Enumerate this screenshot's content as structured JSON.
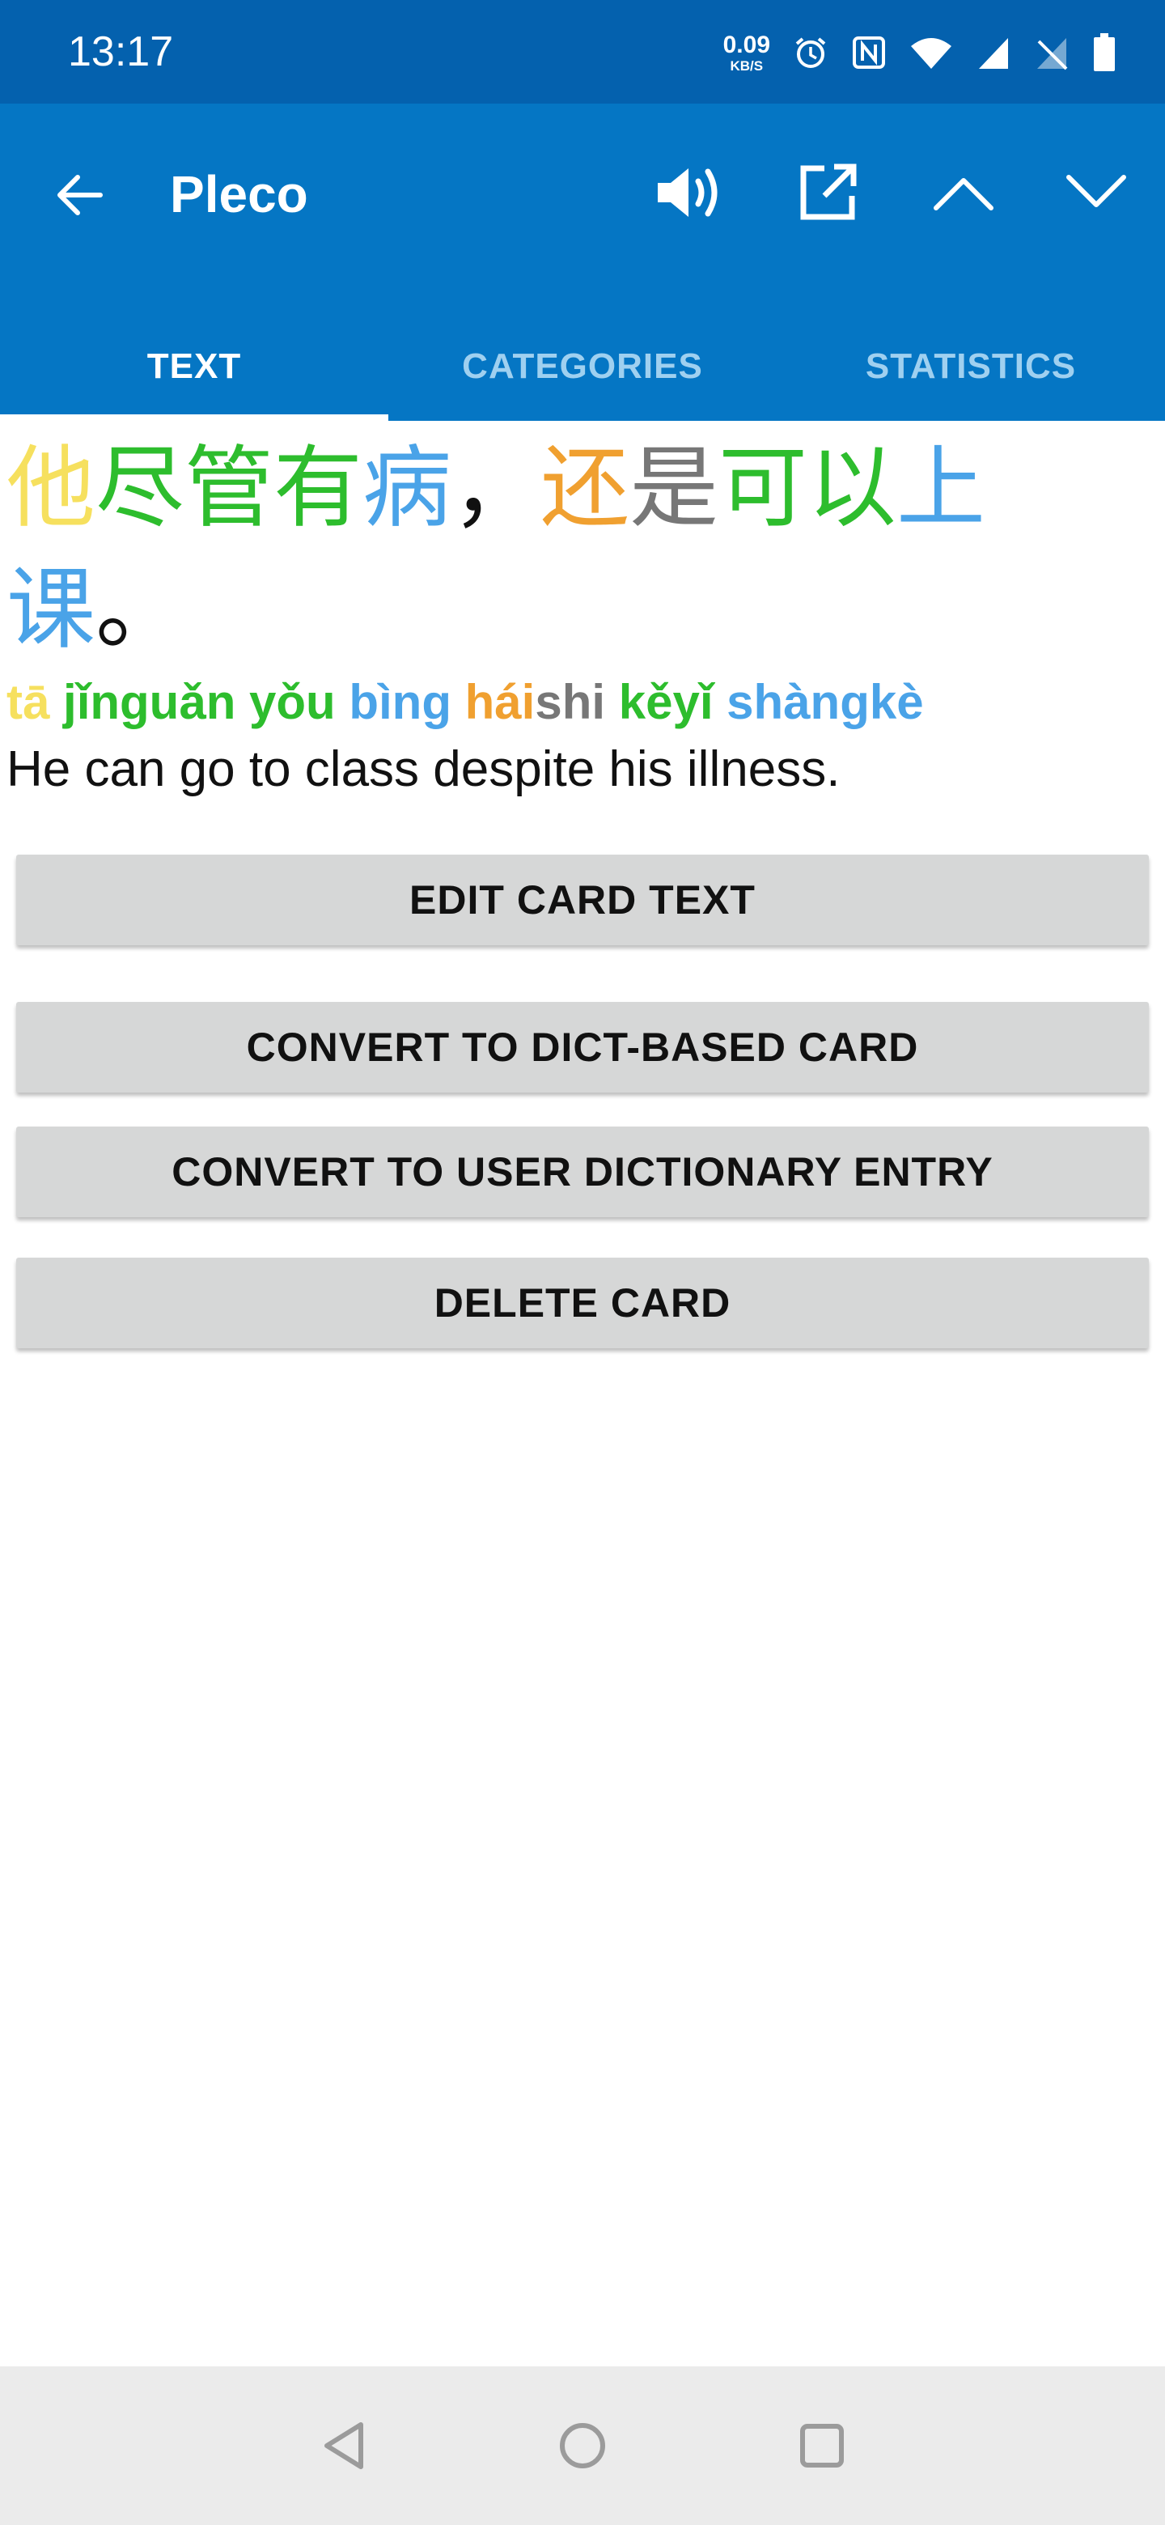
{
  "status": {
    "time": "13:17",
    "net_speed": "0.09",
    "net_unit": "KB/S",
    "icons": [
      "alarm-icon",
      "nfc-icon",
      "wifi-icon",
      "signal-icon",
      "no-signal-icon",
      "battery-icon"
    ]
  },
  "appbar": {
    "title": "Pleco",
    "color": "#0576c4",
    "actions": [
      "speaker-icon",
      "open-external-icon",
      "chevron-up-icon",
      "chevron-down-icon"
    ]
  },
  "tabs": [
    {
      "label": "TEXT",
      "active": true
    },
    {
      "label": "CATEGORIES",
      "active": false
    },
    {
      "label": "STATISTICS",
      "active": false
    }
  ],
  "card": {
    "hanzi_line1": [
      {
        "text": "他",
        "color": "#f6e05e"
      },
      {
        "text": "尽管",
        "color": "#2dbd2d"
      },
      {
        "text": "有",
        "color": "#2dbd2d"
      },
      {
        "text": "病",
        "color": "#4aa3e8"
      },
      {
        "text": "，",
        "color": "#111111"
      },
      {
        "text": "还",
        "color": "#f0a030"
      },
      {
        "text": "是",
        "color": "#777777"
      },
      {
        "text": "可以",
        "color": "#2dbd2d"
      },
      {
        "text": "上",
        "color": "#4aa3e8"
      }
    ],
    "hanzi_line2": [
      {
        "text": "课",
        "color": "#4aa3e8"
      },
      {
        "text": "。",
        "color": "#111111"
      }
    ],
    "pinyin": [
      {
        "text": "tā ",
        "color": "#f6e05e"
      },
      {
        "text": "jǐnguǎn ",
        "color": "#2dbd2d"
      },
      {
        "text": "yǒu ",
        "color": "#2dbd2d"
      },
      {
        "text": "bìng ",
        "color": "#4aa3e8"
      },
      {
        "text": "hái",
        "color": "#f0a030"
      },
      {
        "text": "shi ",
        "color": "#777777"
      },
      {
        "text": "kěyǐ ",
        "color": "#2dbd2d"
      },
      {
        "text": "shàngkè",
        "color": "#4aa3e8"
      }
    ],
    "translation": "He can go to class despite his illness."
  },
  "buttons": {
    "edit": "EDIT CARD TEXT",
    "convert_dict": "CONVERT TO DICT-BASED CARD",
    "convert_user": "CONVERT TO USER DICTIONARY ENTRY",
    "delete": "DELETE CARD"
  },
  "navbar": {
    "icons": [
      "back-triangle-icon",
      "home-circle-icon",
      "recents-square-icon"
    ]
  }
}
